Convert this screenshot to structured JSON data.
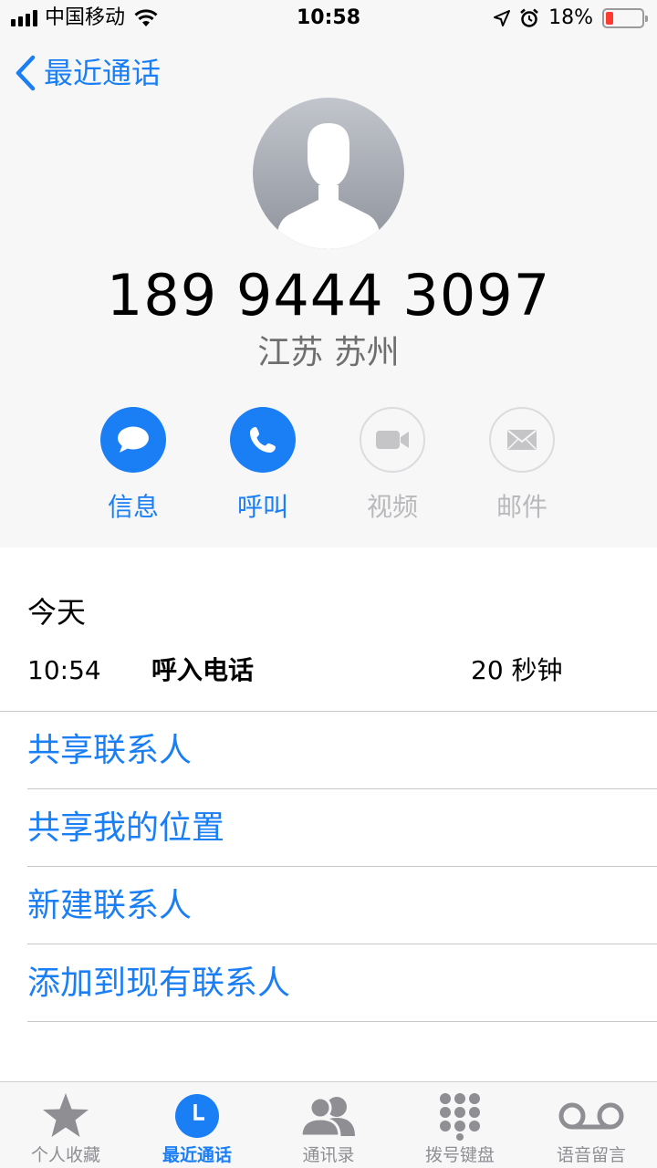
{
  "status_bar": {
    "carrier": "中国移动",
    "time": "10:58",
    "battery_percent": "18%",
    "icons": [
      "signal-icon",
      "wifi-icon",
      "location-icon",
      "alarm-icon",
      "battery-icon"
    ]
  },
  "nav": {
    "back_label": "最近通话"
  },
  "contact": {
    "number": "189 9444 3097",
    "location": "江苏 苏州"
  },
  "actions": [
    {
      "label": "信息",
      "icon": "message-icon",
      "enabled": true
    },
    {
      "label": "呼叫",
      "icon": "phone-icon",
      "enabled": true
    },
    {
      "label": "视频",
      "icon": "video-icon",
      "enabled": false
    },
    {
      "label": "邮件",
      "icon": "mail-icon",
      "enabled": false
    }
  ],
  "history": {
    "day": "今天",
    "calls": [
      {
        "time": "10:54",
        "type": "呼入电话",
        "duration": "20 秒钟"
      }
    ]
  },
  "options": [
    {
      "label": "共享联系人"
    },
    {
      "label": "共享我的位置"
    },
    {
      "label": "新建联系人"
    },
    {
      "label": "添加到现有联系人"
    }
  ],
  "tabbar": {
    "tabs": [
      {
        "label": "个人收藏",
        "icon": "star-icon",
        "active": false
      },
      {
        "label": "最近通话",
        "icon": "clock-icon",
        "active": true
      },
      {
        "label": "通讯录",
        "icon": "contacts-icon",
        "active": false
      },
      {
        "label": "拨号键盘",
        "icon": "keypad-icon",
        "active": false
      },
      {
        "label": "语音留言",
        "icon": "voicemail-icon",
        "active": false
      }
    ]
  },
  "colors": {
    "accent": "#1a7ef5",
    "disabled": "#b9b9bc",
    "battery_low": "#ff3b30"
  }
}
